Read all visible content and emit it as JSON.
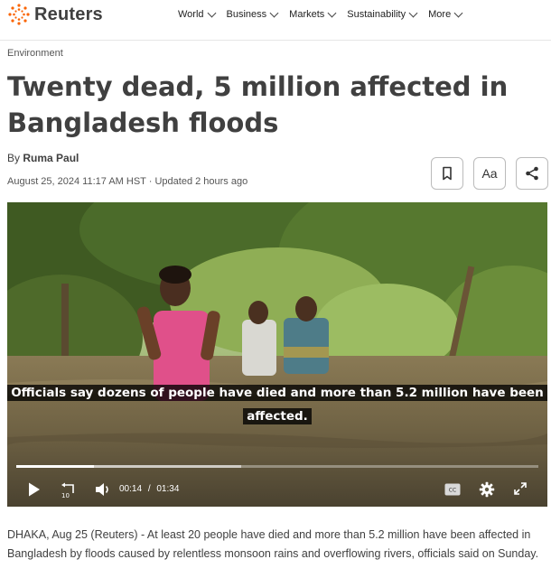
{
  "brand": {
    "name": "Reuters",
    "accent": "#fa6400"
  },
  "nav": {
    "items": [
      "World",
      "Business",
      "Markets",
      "Sustainability",
      "More"
    ]
  },
  "article": {
    "section": "Environment",
    "headline": "Twenty dead, 5 million affected in Bangladesh floods",
    "byline_prefix": "By",
    "author": "Ruma Paul",
    "date": "August 25, 2024 11:17 AM HST · Updated 2 hours ago",
    "font_button_label": "Aa",
    "body": "DHAKA, Aug 25 (Reuters) - At least 20 people have died and more than 5.2 million have been affected in Bangladesh by floods caused by relentless monsoon rains and overflowing rivers, officials said on Sunday."
  },
  "video": {
    "caption": "Officials say dozens of people have died and more than 5.2 million have been affected.",
    "current_time": "00:14",
    "time_separator": "/",
    "duration": "01:34",
    "progress_fraction": 0.149,
    "cc_label": "CC",
    "replay_label": "10"
  },
  "icons": {
    "bookmark": "bookmark-icon",
    "share": "share-icon",
    "play": "play-icon",
    "replay": "replay-10-icon",
    "volume": "volume-icon",
    "captions": "closed-captions-icon",
    "settings": "gear-icon",
    "fullscreen": "fullscreen-icon"
  }
}
